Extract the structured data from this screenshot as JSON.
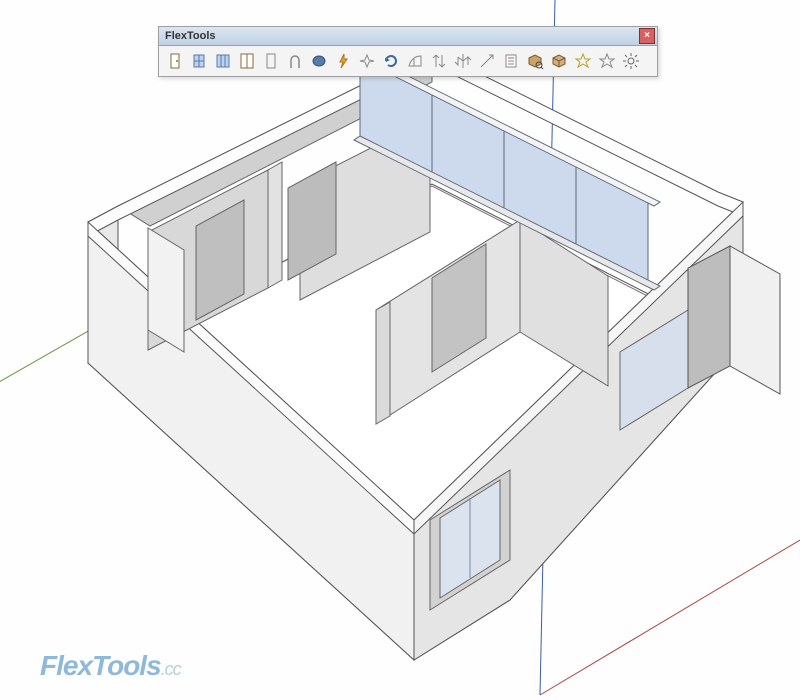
{
  "toolbar": {
    "title": "FlexTools",
    "close_label": "×",
    "buttons": [
      {
        "name": "flex-door",
        "label": "Flex Door"
      },
      {
        "name": "flex-window",
        "label": "Flex Window"
      },
      {
        "name": "flex-window-double",
        "label": "Flex Window Double"
      },
      {
        "name": "flex-door-double",
        "label": "Flex Door Double"
      },
      {
        "name": "flex-opening",
        "label": "Flex Opening"
      },
      {
        "name": "flex-arch",
        "label": "Flex Arch"
      },
      {
        "name": "flex-circle",
        "label": "Flex Circle"
      },
      {
        "name": "zap",
        "label": "Zap"
      },
      {
        "name": "sparkle",
        "label": "Convert"
      },
      {
        "name": "refresh",
        "label": "Refresh"
      },
      {
        "name": "wall-cutter",
        "label": "Wall Cutter"
      },
      {
        "name": "flip",
        "label": "Flip"
      },
      {
        "name": "swap",
        "label": "Swap"
      },
      {
        "name": "scale",
        "label": "Scale"
      },
      {
        "name": "report",
        "label": "Report"
      },
      {
        "name": "component-finder",
        "label": "Component Finder"
      },
      {
        "name": "local-lib",
        "label": "Local Library"
      },
      {
        "name": "favorite-a",
        "label": "Favorite A"
      },
      {
        "name": "favorite-b",
        "label": "Favorite B"
      },
      {
        "name": "settings",
        "label": "Settings"
      }
    ]
  },
  "watermark": {
    "brand": "FlexTools",
    "ext": ".cc"
  }
}
